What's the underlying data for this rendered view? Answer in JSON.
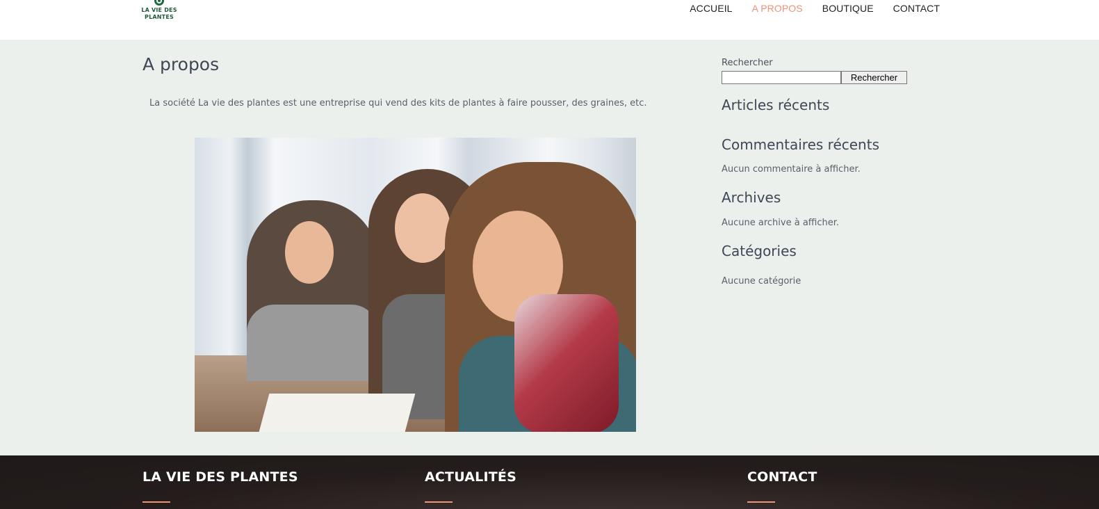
{
  "header": {
    "logo_text_line1": "LA VIE DES",
    "logo_text_line2": "PLANTES",
    "nav": [
      {
        "label": "ACCUEIL",
        "active": false
      },
      {
        "label": "A PROPOS",
        "active": true
      },
      {
        "label": "BOUTIQUE",
        "active": false
      },
      {
        "label": "CONTACT",
        "active": false
      }
    ],
    "accent_color": "#f0917a"
  },
  "main": {
    "title": "A propos",
    "intro": "La société La vie des plantes est une entreprise qui vend des kits de plantes à faire pousser, des graines, etc."
  },
  "sidebar": {
    "search_label": "Rechercher",
    "search_value": "",
    "search_button": "Rechercher",
    "recent_articles_title": "Articles récents",
    "recent_comments_title": "Commentaires récents",
    "recent_comments_text": "Aucun commentaire à afficher.",
    "archives_title": "Archives",
    "archives_text": "Aucune archive à afficher.",
    "categories_title": "Catégories",
    "categories_text": "Aucune catégorie"
  },
  "footer": {
    "col1_title": "LA VIE DES PLANTES",
    "col2_title": "ACTUALITÉS",
    "col3_title": "CONTACT"
  }
}
